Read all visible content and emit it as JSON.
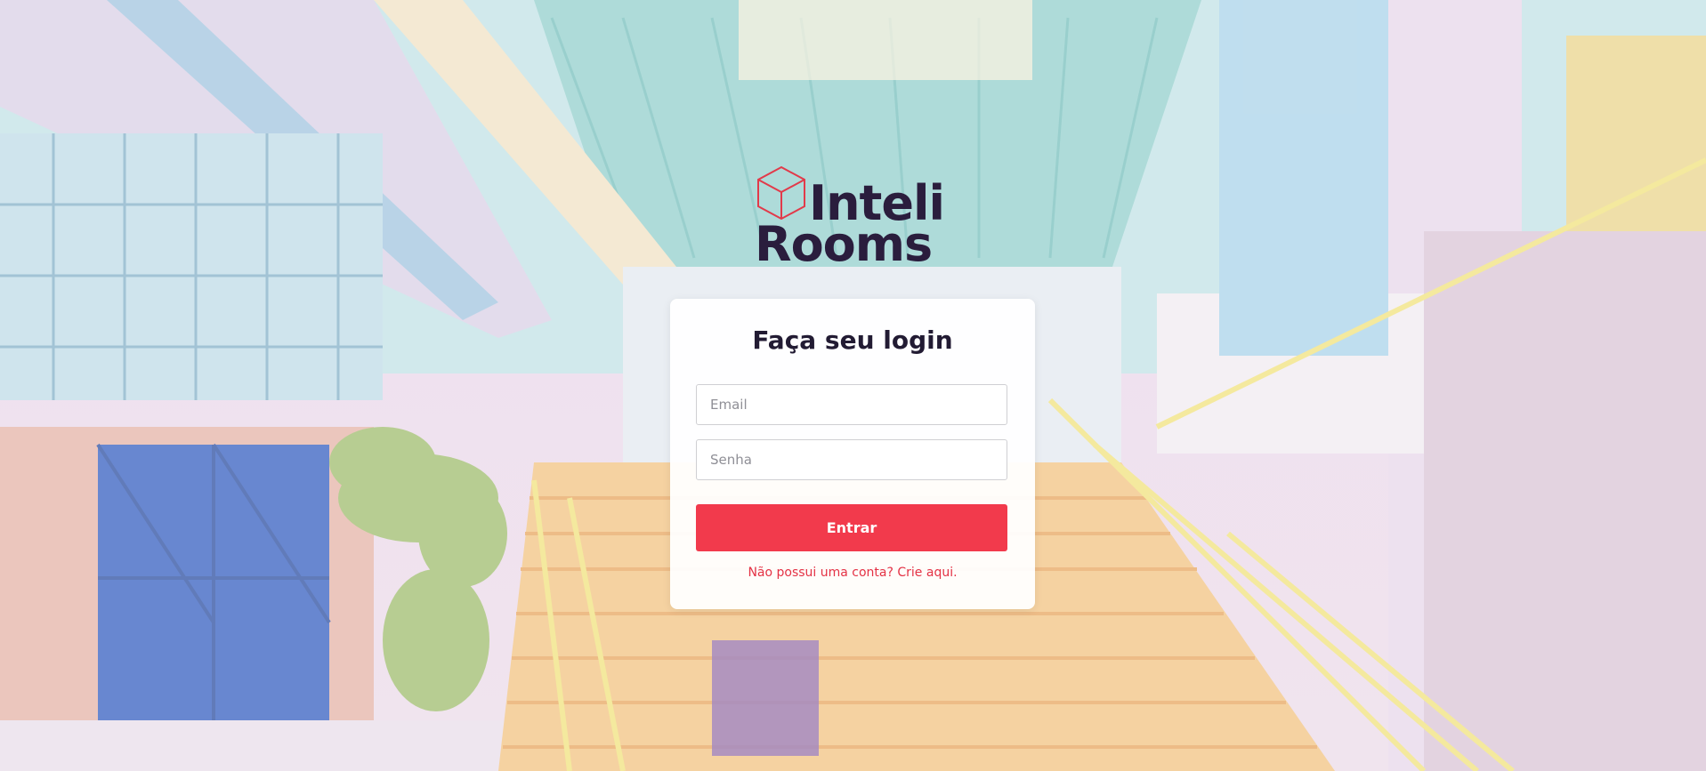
{
  "brand": {
    "line1": "Inteli",
    "line2": "Rooms",
    "text_color": "#2a1d3d",
    "cube_color": "#e23a4a"
  },
  "login": {
    "title": "Faça seu login",
    "email_placeholder": "Email",
    "password_placeholder": "Senha",
    "submit_label": "Entrar",
    "signup_text": "Não possui uma conta? Crie aqui.",
    "accent_color": "#f23a4c"
  }
}
